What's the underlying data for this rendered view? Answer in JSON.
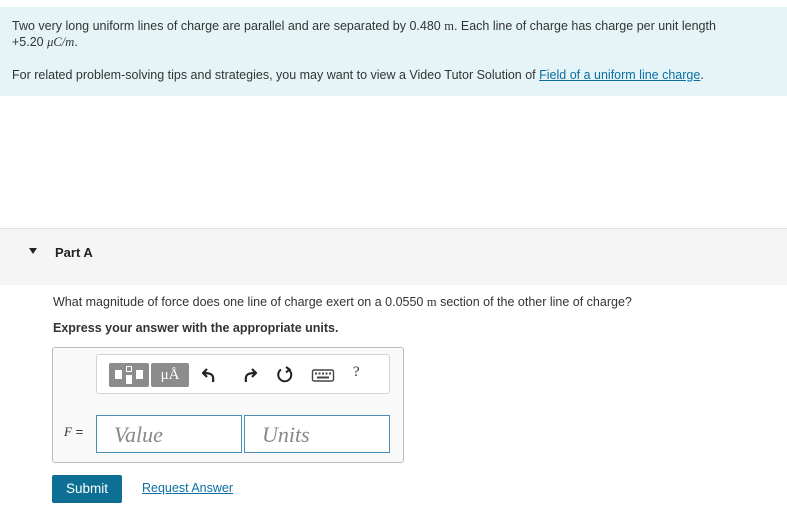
{
  "problem": {
    "text_a": "Two very long uniform lines of charge are parallel and are separated by 0.480 ",
    "sep_unit": "m",
    "text_b": ". Each line of charge has charge per unit length",
    "charge_value": "+5.20 ",
    "charge_unit": "μC/m",
    "charge_end": ".",
    "tip_prefix": "For related problem-solving tips and strategies, you may want to view a Video Tutor Solution of ",
    "tip_link": "Field of a uniform line charge",
    "tip_suffix": "."
  },
  "part": {
    "title": "Part A",
    "question_a": "What magnitude of force does one line of charge exert on a 0.0550 ",
    "question_unit": "m",
    "question_b": " section of the other line of charge?",
    "instruction": "Express your answer with the appropriate units."
  },
  "answer": {
    "variable": "F",
    "equals": " =",
    "value_placeholder": "Value",
    "units_placeholder": "Units",
    "unit_button_label": "μÅ",
    "help_label": "?"
  },
  "actions": {
    "submit": "Submit",
    "request": "Request Answer"
  },
  "icons": [
    "templates-icon",
    "units-icon",
    "undo-icon",
    "redo-icon",
    "reset-icon",
    "keyboard-icon",
    "help-icon"
  ],
  "colors": {
    "intro_bg": "#e5f5f7",
    "link": "#0b6ea3",
    "submit_bg": "#0d6f94",
    "input_border": "#4a8fb8"
  }
}
